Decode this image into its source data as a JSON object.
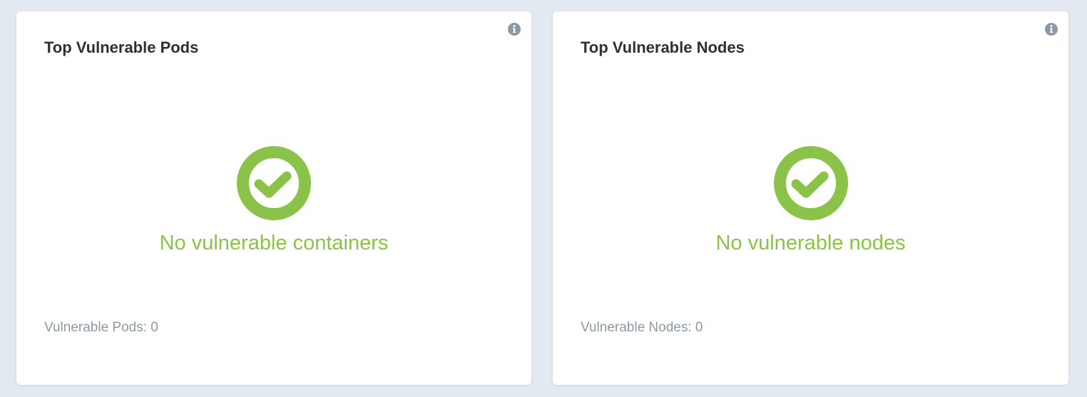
{
  "pods_card": {
    "title": "Top Vulnerable Pods",
    "icon": "info-icon",
    "status_icon": "check-circle-icon",
    "empty_message": "No vulnerable containers",
    "summary": "Vulnerable Pods: 0"
  },
  "nodes_card": {
    "title": "Top Vulnerable Nodes",
    "icon": "info-icon",
    "status_icon": "check-circle-icon",
    "empty_message": "No vulnerable nodes",
    "summary": "Vulnerable Nodes: 0"
  },
  "colors": {
    "success": "#8bc34a",
    "title_text": "#2f3033",
    "muted_text": "#8d9aa6",
    "info_icon": "#8d99a4",
    "page_background": "#e2e9f0"
  }
}
